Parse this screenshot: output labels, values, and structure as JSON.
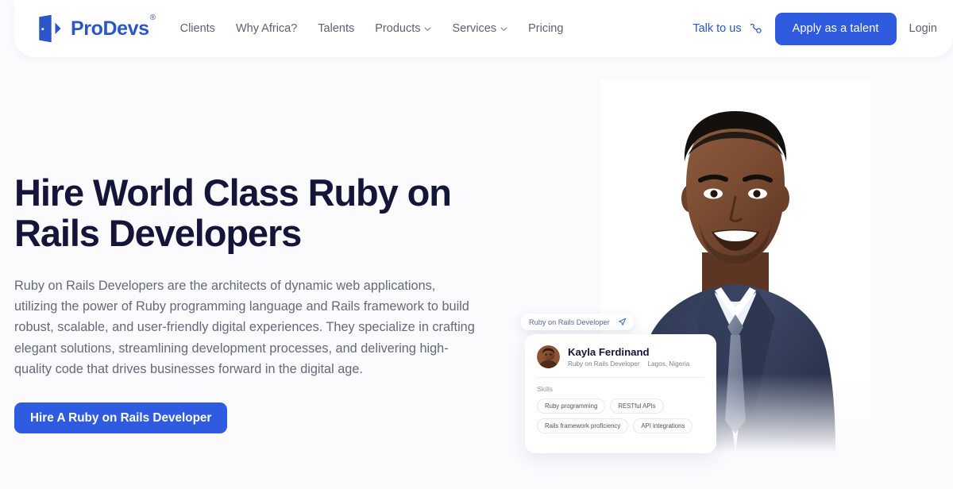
{
  "header": {
    "logo": {
      "text": "ProDevs",
      "registered": "®",
      "icon": "door-logo-icon"
    },
    "nav": [
      {
        "label": "Clients",
        "has_dropdown": false
      },
      {
        "label": "Why Africa?",
        "has_dropdown": false
      },
      {
        "label": "Talents",
        "has_dropdown": false
      },
      {
        "label": "Products",
        "has_dropdown": true
      },
      {
        "label": "Services",
        "has_dropdown": true
      },
      {
        "label": "Pricing",
        "has_dropdown": false
      }
    ],
    "talk_to_us": "Talk to us",
    "apply_button": "Apply as a talent",
    "login": "Login"
  },
  "hero": {
    "title": "Hire World Class Ruby on Rails Developers",
    "description": "Ruby on Rails Developers are the architects of dynamic web applications, utilizing the power of Ruby programming language and Rails framework to build robust, scalable, and user-friendly digital experiences. They specialize in crafting elegant solutions, streamlining development processes, and delivering high-quality code that drives businesses forward in the digital age.",
    "cta_button": "Hire A Ruby on Rails Developer"
  },
  "floating_pill": {
    "label": "Ruby on Rails Developer"
  },
  "talent_card": {
    "name": "Kayla Ferdinand",
    "role": "Ruby on Rails Developer",
    "location": "Lagos, Nigeria",
    "skills_label": "Skills",
    "skills": [
      "Ruby programming",
      "RESTful APIs",
      "Rails framework proficiency",
      "API integrations"
    ]
  },
  "colors": {
    "brand_blue": "#2E5BE0",
    "logo_blue": "#2B55C9",
    "heading_navy": "#15153A",
    "body_gray": "#646A78",
    "page_background": "#FBFBFE"
  }
}
